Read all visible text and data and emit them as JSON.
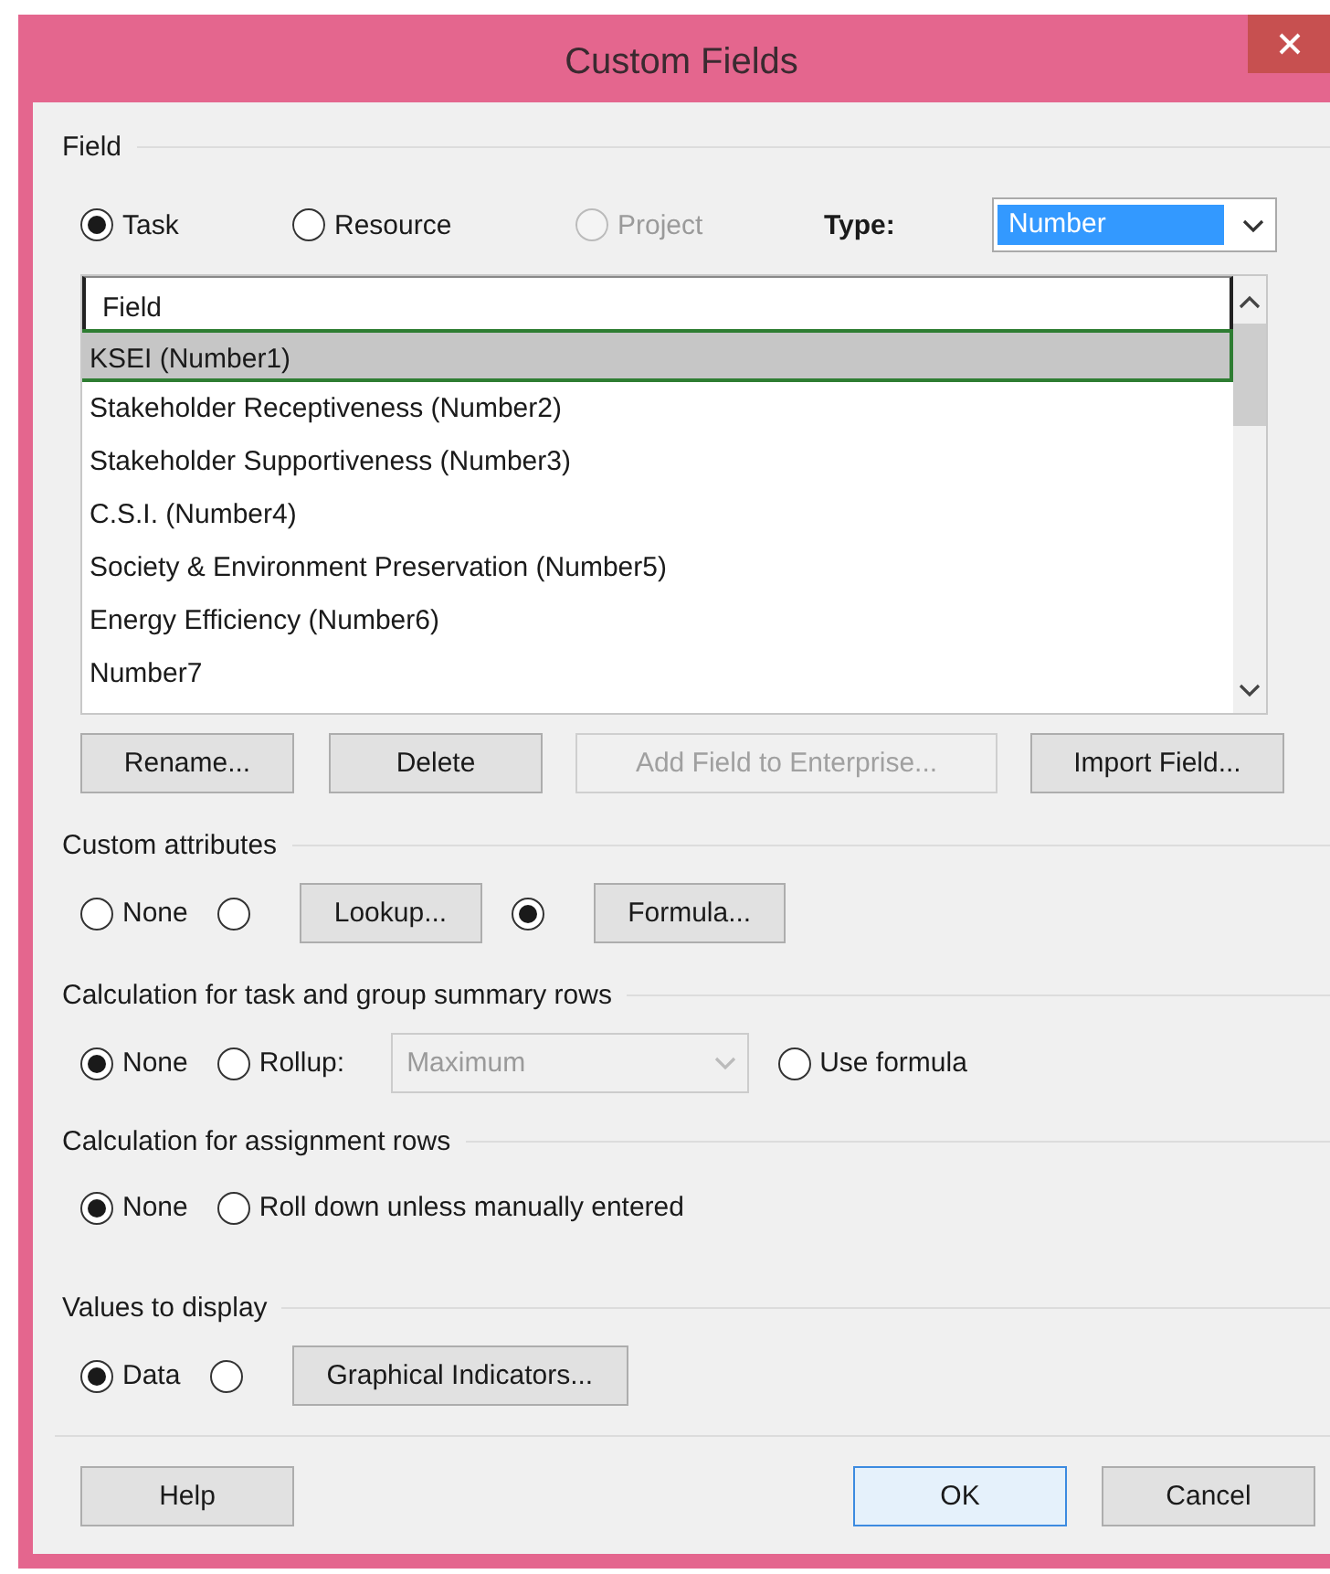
{
  "window": {
    "title": "Custom Fields"
  },
  "field_section": {
    "label": "Field",
    "scope_options": [
      {
        "label": "Task",
        "selected": true,
        "disabled": false
      },
      {
        "label": "Resource",
        "selected": false,
        "disabled": false
      },
      {
        "label": "Project",
        "selected": false,
        "disabled": true
      }
    ],
    "type_label": "Type:",
    "type_value": "Number"
  },
  "field_list": {
    "header": "Field",
    "rows": [
      {
        "label": "KSEI (Number1)",
        "selected": true
      },
      {
        "label": "Stakeholder Receptiveness (Number2)",
        "selected": false
      },
      {
        "label": "Stakeholder Supportiveness (Number3)",
        "selected": false
      },
      {
        "label": "C.S.I. (Number4)",
        "selected": false
      },
      {
        "label": "Society & Environment Preservation (Number5)",
        "selected": false
      },
      {
        "label": "Energy Efficiency (Number6)",
        "selected": false
      },
      {
        "label": "Number7",
        "selected": false
      }
    ]
  },
  "field_buttons": [
    {
      "label": "Rename...",
      "disabled": false
    },
    {
      "label": "Delete",
      "disabled": false
    },
    {
      "label": "Add Field to Enterprise...",
      "disabled": true
    },
    {
      "label": "Import Field...",
      "disabled": false
    }
  ],
  "sections": [
    {
      "label": "Custom attributes",
      "options": [
        {
          "kind": "radio",
          "label": "None",
          "selected": false
        },
        {
          "kind": "radio_button",
          "button": "Lookup...",
          "selected": false
        },
        {
          "kind": "radio_button",
          "button": "Formula...",
          "selected": true
        }
      ]
    },
    {
      "label": "Calculation for task and group summary rows",
      "options": [
        {
          "kind": "radio",
          "label": "None",
          "selected": true
        },
        {
          "kind": "radio_dropdown",
          "label": "Rollup:",
          "dropdown": "Maximum",
          "dropdown_disabled": true,
          "selected": false
        },
        {
          "kind": "radio",
          "label": "Use formula",
          "selected": false
        }
      ]
    },
    {
      "label": "Calculation for assignment rows",
      "options": [
        {
          "kind": "radio",
          "label": "None",
          "selected": true
        },
        {
          "kind": "radio",
          "label": "Roll down unless manually entered",
          "selected": false
        }
      ]
    },
    {
      "label": "Values to display",
      "options": [
        {
          "kind": "radio",
          "label": "Data",
          "selected": true
        },
        {
          "kind": "radio_button",
          "button": "Graphical Indicators...",
          "selected": false
        }
      ]
    }
  ],
  "footer_buttons": [
    {
      "label": "Help",
      "default": false
    },
    {
      "label": "OK",
      "default": true
    },
    {
      "label": "Cancel",
      "default": false
    }
  ]
}
